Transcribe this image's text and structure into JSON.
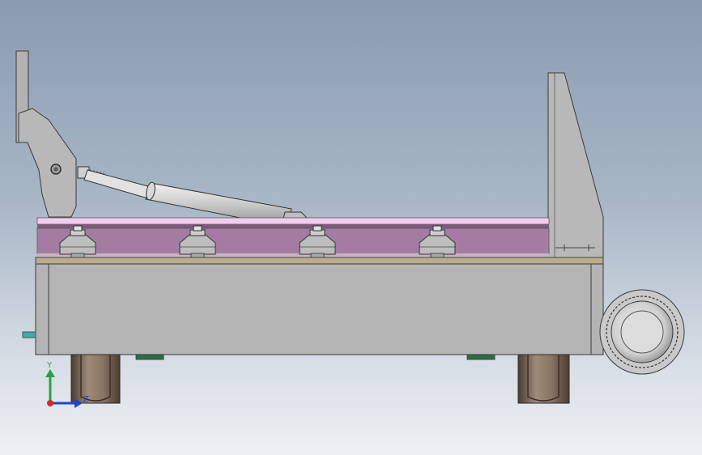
{
  "viewport": {
    "background_top": "#8a9bb0",
    "background_bottom": "#eef1f4"
  },
  "model": {
    "colors": {
      "steel": "#b4b4b4",
      "steel_dark": "#8e8e8e",
      "steel_light": "#d2d2d2",
      "table_top": "#f0c8ec",
      "table_rail": "#a47aa0",
      "table_rail_dark": "#7a5a78",
      "base_strip": "#b9ad8a",
      "wheel_brown": "#6e5a4c",
      "foot_green": "#2f6b4a",
      "cylinder": "#d4d4d4"
    },
    "clamps_count": 4,
    "icons": [
      "triad-icon"
    ]
  },
  "triad": {
    "y_label": "Y",
    "z_label": "Z",
    "y_color": "#2ea043",
    "z_color": "#2147c9",
    "x_color": "#d42a2a"
  }
}
